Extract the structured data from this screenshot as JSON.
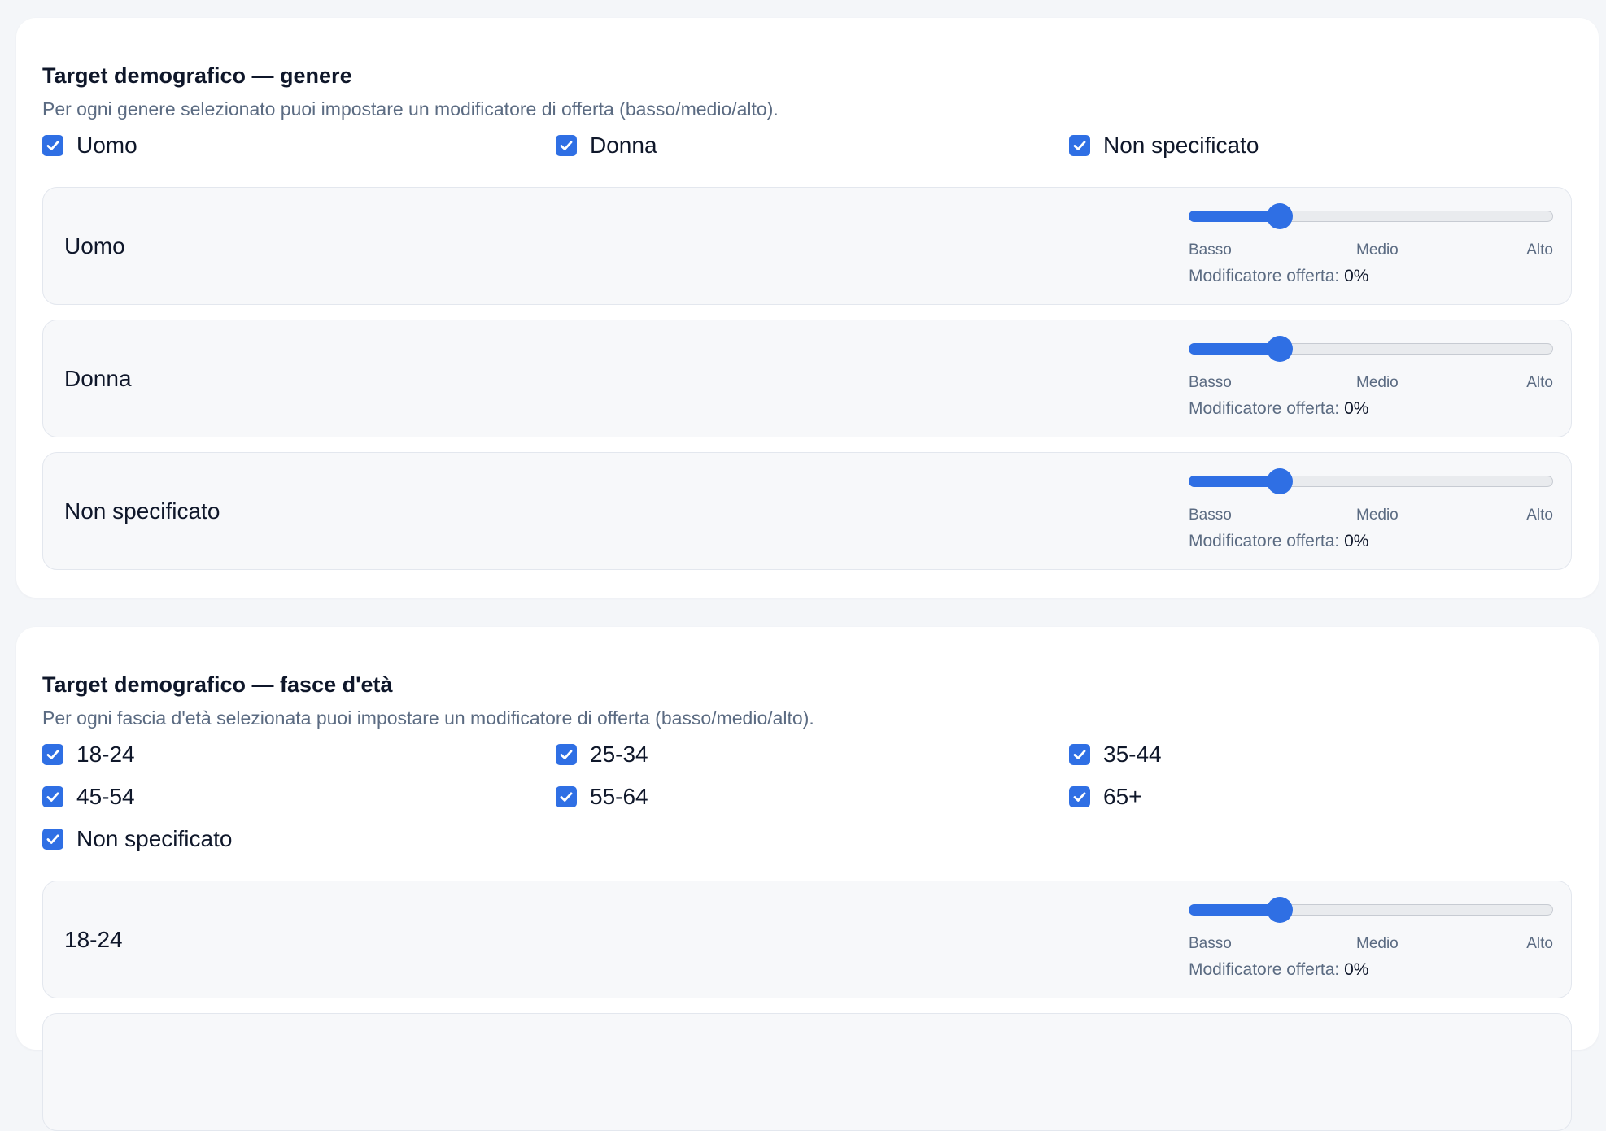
{
  "gender": {
    "title": "Target demografico — genere",
    "description": "Per ogni genere selezionato puoi impostare un modificatore di offerta (basso/medio/alto).",
    "options": [
      {
        "label": "Uomo",
        "checked": true
      },
      {
        "label": "Donna",
        "checked": true
      },
      {
        "label": "Non specificato",
        "checked": true
      }
    ],
    "rows": [
      {
        "label": "Uomo",
        "level": 0.25,
        "tick_low": "Basso",
        "tick_mid": "Medio",
        "tick_high": "Alto",
        "modifier_label": "Modificatore offerta:",
        "modifier_value": "0%"
      },
      {
        "label": "Donna",
        "level": 0.25,
        "tick_low": "Basso",
        "tick_mid": "Medio",
        "tick_high": "Alto",
        "modifier_label": "Modificatore offerta:",
        "modifier_value": "0%"
      },
      {
        "label": "Non specificato",
        "level": 0.25,
        "tick_low": "Basso",
        "tick_mid": "Medio",
        "tick_high": "Alto",
        "modifier_label": "Modificatore offerta:",
        "modifier_value": "0%"
      }
    ]
  },
  "age": {
    "title": "Target demografico — fasce d'età",
    "description": "Per ogni fascia d'età selezionata puoi impostare un modificatore di offerta (basso/medio/alto).",
    "options": [
      {
        "label": "18-24",
        "checked": true
      },
      {
        "label": "25-34",
        "checked": true
      },
      {
        "label": "35-44",
        "checked": true
      },
      {
        "label": "45-54",
        "checked": true
      },
      {
        "label": "55-64",
        "checked": true
      },
      {
        "label": "65+",
        "checked": true
      },
      {
        "label": "Non specificato",
        "checked": true
      }
    ],
    "rows": [
      {
        "label": "18-24",
        "level": 0.25,
        "tick_low": "Basso",
        "tick_mid": "Medio",
        "tick_high": "Alto",
        "modifier_label": "Modificatore offerta:",
        "modifier_value": "0%"
      }
    ]
  },
  "colors": {
    "accent": "#2f6fe4",
    "panel_bg": "#f7f8fa",
    "page_bg": "#f4f6f9",
    "muted_text": "#5b6b82"
  },
  "icons": {
    "checkbox": "checkmark-icon"
  }
}
